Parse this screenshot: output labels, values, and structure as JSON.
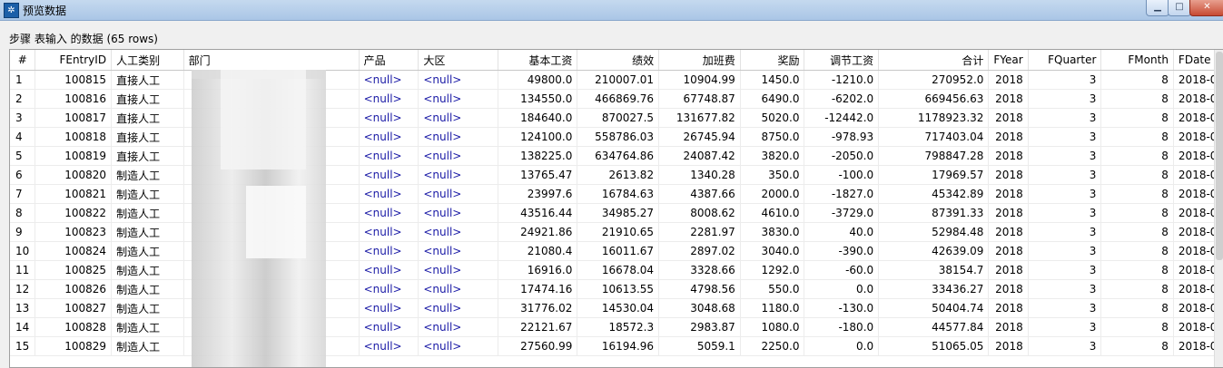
{
  "window": {
    "title": "预览数据",
    "app_icon": "gear-icon"
  },
  "caption": "步骤 表输入 的数据 (65 rows)",
  "columns": [
    "#",
    "FEntryID",
    "人工类别",
    "部门",
    "产品",
    "大区",
    "基本工资",
    "绩效",
    "加班费",
    "奖励",
    "调节工资",
    "合计",
    "FYear",
    "FQuarter",
    "FMonth",
    "FDate"
  ],
  "rows": [
    [
      "1",
      "100815",
      "直接人工",
      "",
      "<null>",
      "<null>",
      "49800.0",
      "210007.01",
      "10904.99",
      "1450.0",
      "-1210.0",
      "270952.0",
      "2018",
      "3",
      "8",
      "2018-0"
    ],
    [
      "2",
      "100816",
      "直接人工",
      "",
      "<null>",
      "<null>",
      "134550.0",
      "466869.76",
      "67748.87",
      "6490.0",
      "-6202.0",
      "669456.63",
      "2018",
      "3",
      "8",
      "2018-0"
    ],
    [
      "3",
      "100817",
      "直接人工",
      "",
      "<null>",
      "<null>",
      "184640.0",
      "870027.5",
      "131677.82",
      "5020.0",
      "-12442.0",
      "1178923.32",
      "2018",
      "3",
      "8",
      "2018-0"
    ],
    [
      "4",
      "100818",
      "直接人工",
      "",
      "<null>",
      "<null>",
      "124100.0",
      "558786.03",
      "26745.94",
      "8750.0",
      "-978.93",
      "717403.04",
      "2018",
      "3",
      "8",
      "2018-0"
    ],
    [
      "5",
      "100819",
      "直接人工",
      "",
      "<null>",
      "<null>",
      "138225.0",
      "634764.86",
      "24087.42",
      "3820.0",
      "-2050.0",
      "798847.28",
      "2018",
      "3",
      "8",
      "2018-0"
    ],
    [
      "6",
      "100820",
      "制造人工",
      "",
      "<null>",
      "<null>",
      "13765.47",
      "2613.82",
      "1340.28",
      "350.0",
      "-100.0",
      "17969.57",
      "2018",
      "3",
      "8",
      "2018-0"
    ],
    [
      "7",
      "100821",
      "制造人工",
      "",
      "<null>",
      "<null>",
      "23997.6",
      "16784.63",
      "4387.66",
      "2000.0",
      "-1827.0",
      "45342.89",
      "2018",
      "3",
      "8",
      "2018-0"
    ],
    [
      "8",
      "100822",
      "制造人工",
      "",
      "<null>",
      "<null>",
      "43516.44",
      "34985.27",
      "8008.62",
      "4610.0",
      "-3729.0",
      "87391.33",
      "2018",
      "3",
      "8",
      "2018-0"
    ],
    [
      "9",
      "100823",
      "制造人工",
      "",
      "<null>",
      "<null>",
      "24921.86",
      "21910.65",
      "2281.97",
      "3830.0",
      "40.0",
      "52984.48",
      "2018",
      "3",
      "8",
      "2018-0"
    ],
    [
      "10",
      "100824",
      "制造人工",
      "",
      "<null>",
      "<null>",
      "21080.4",
      "16011.67",
      "2897.02",
      "3040.0",
      "-390.0",
      "42639.09",
      "2018",
      "3",
      "8",
      "2018-0"
    ],
    [
      "11",
      "100825",
      "制造人工",
      "",
      "<null>",
      "<null>",
      "16916.0",
      "16678.04",
      "3328.66",
      "1292.0",
      "-60.0",
      "38154.7",
      "2018",
      "3",
      "8",
      "2018-0"
    ],
    [
      "12",
      "100826",
      "制造人工",
      "",
      "<null>",
      "<null>",
      "17474.16",
      "10613.55",
      "4798.56",
      "550.0",
      "0.0",
      "33436.27",
      "2018",
      "3",
      "8",
      "2018-0"
    ],
    [
      "13",
      "100827",
      "制造人工",
      "",
      "<null>",
      "<null>",
      "31776.02",
      "14530.04",
      "3048.68",
      "1180.0",
      "-130.0",
      "50404.74",
      "2018",
      "3",
      "8",
      "2018-0"
    ],
    [
      "14",
      "100828",
      "制造人工",
      "",
      "<null>",
      "<null>",
      "22121.67",
      "18572.3",
      "2983.87",
      "1080.0",
      "-180.0",
      "44577.84",
      "2018",
      "3",
      "8",
      "2018-0"
    ],
    [
      "15",
      "100829",
      "制造人工",
      "",
      "<null>",
      "<null>",
      "27560.99",
      "16194.96",
      "5059.1",
      "2250.0",
      "0.0",
      "51065.05",
      "2018",
      "3",
      "8",
      "2018-0"
    ]
  ],
  "column_align": [
    "idx",
    "num",
    "txt",
    "txt",
    "txt",
    "txt",
    "num",
    "num",
    "num",
    "num",
    "num",
    "num",
    "num",
    "num",
    "num",
    "txt"
  ]
}
